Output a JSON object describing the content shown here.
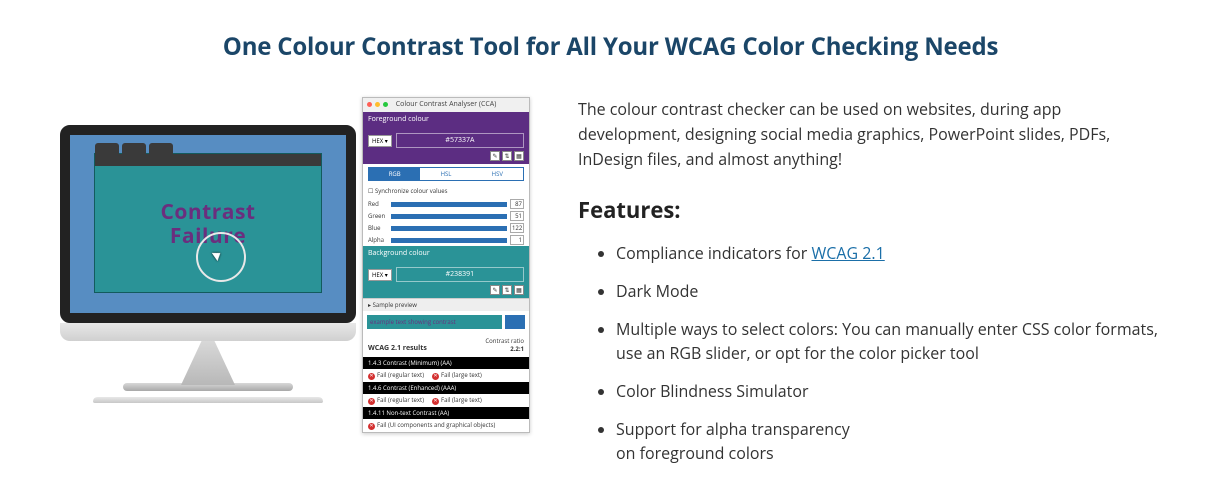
{
  "title": "One Colour Contrast Tool for All Your WCAG Color Checking Needs",
  "intro": "The colour contrast checker can be used on websites, during app development, designing social media graphics, PowerPoint slides, PDFs, InDesign files, and almost anything!",
  "features_heading": "Features:",
  "features": {
    "f1_pre": "Compliance indicators for ",
    "f1_link": "WCAG 2.1",
    "f2": "Dark Mode",
    "f3": "Multiple ways to select colors: You can manually enter CSS color formats, use an RGB slider, or opt for the color picker tool",
    "f4": "Color Blindness Simulator",
    "f5_l1": "Support for alpha transparency",
    "f5_l2": "on foreground colors"
  },
  "mock": {
    "contrast_failure_l1": "Contrast",
    "contrast_failure_l2": "Failure",
    "app_title": "Colour Contrast Analyser (CCA)",
    "fg_label": "Foreground colour",
    "bg_label": "Background colour",
    "hex_label": "HEX",
    "fg_value": "#57337A",
    "bg_value": "#238391",
    "tabs": {
      "rgb": "RGB",
      "hsl": "HSL",
      "hsv": "HSV"
    },
    "sync": "Synchronize colour values",
    "sliders": {
      "red": {
        "label": "Red",
        "value": "87"
      },
      "green": {
        "label": "Green",
        "value": "51"
      },
      "blue": {
        "label": "Blue",
        "value": "122"
      },
      "alpha": {
        "label": "Alpha",
        "value": "1"
      }
    },
    "sample_preview": "Sample preview",
    "sample_text": "example text showing contrast",
    "results_heading": "WCAG 2.1 results",
    "ratio_label": "Contrast ratio",
    "ratio_value": "2.2:1",
    "rules": {
      "r1": "1.4.3 Contrast (Minimum) (AA)",
      "r2": "1.4.6 Contrast (Enhanced) (AAA)",
      "r3": "1.4.11 Non-text Contrast (AA)"
    },
    "fail_regular": "Fail (regular text)",
    "fail_large": "Fail (large text)",
    "fail_ui": "Fail (UI components and graphical objects)"
  }
}
